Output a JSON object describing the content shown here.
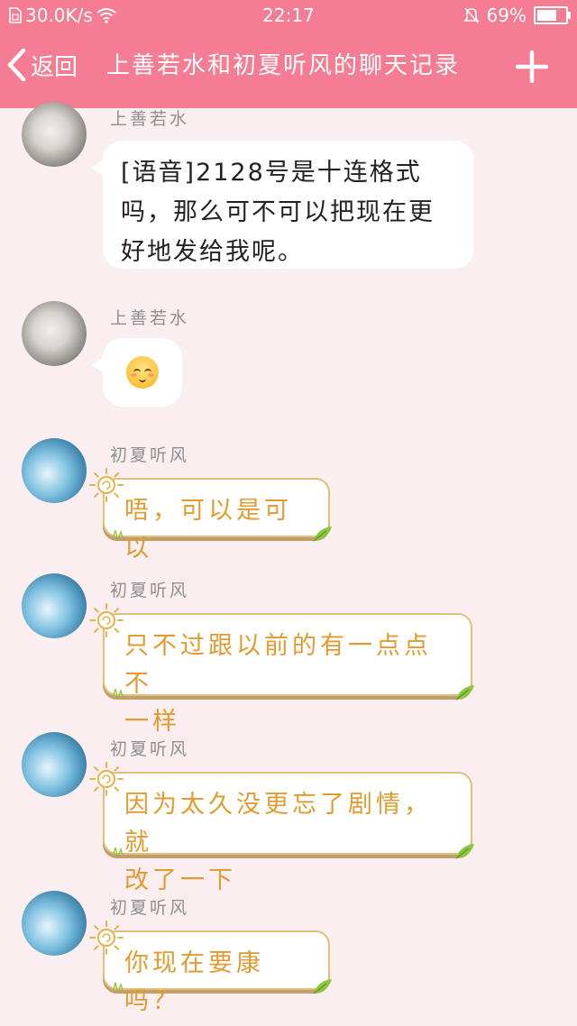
{
  "status": {
    "net_speed": "30.0K/s",
    "time": "22:17",
    "battery": "69%",
    "battery_level": 0.69
  },
  "header": {
    "back_label": "返回",
    "title": "上善若水和初夏听风的聊天记录"
  },
  "messages": [
    {
      "sender": "上善若水",
      "text": "[语音]2128号是十连格式吗，那么可不可以把现在更好地发给我呢。",
      "lines": [
        "[语音]2128号是十连格式",
        "吗，那么可不可以把现在更",
        "好地发给我呢。"
      ]
    },
    {
      "sender": "上善若水",
      "emoji": "blush-emoji"
    },
    {
      "sender": "初夏听风",
      "text": "唔，可以是可以"
    },
    {
      "sender": "初夏听风",
      "text": "只不过跟以前的有一点点不一样",
      "lines": [
        "只不过跟以前的有一点点不",
        "一样"
      ]
    },
    {
      "sender": "初夏听风",
      "text": "因为太久没更忘了剧情，就改了一下",
      "lines": [
        "因为太久没更忘了剧情，就",
        "改了一下"
      ]
    },
    {
      "sender": "初夏听风",
      "text": "你现在要康吗？"
    }
  ],
  "colors": {
    "header_bg": "#f47c93",
    "page_bg": "#fbeef1",
    "sun_text": "#e39a2e",
    "sun_border": "#e0c07a"
  }
}
